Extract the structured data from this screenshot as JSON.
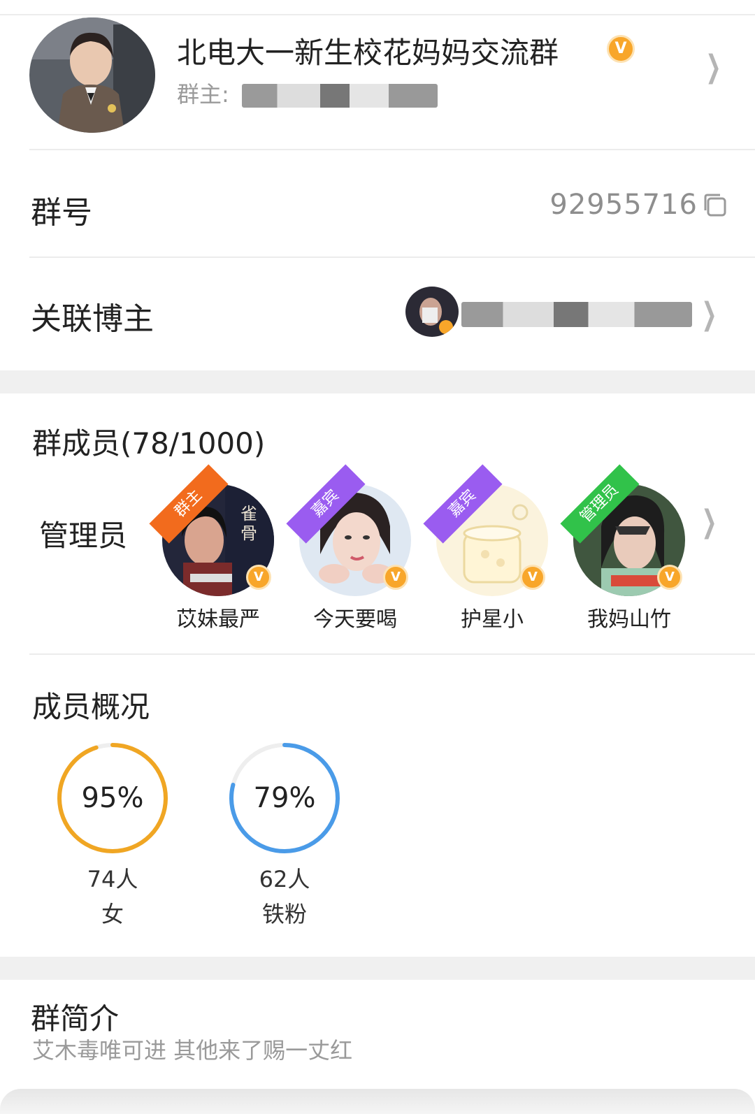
{
  "header": {
    "group_name": "北电大一新生校花妈妈交流群",
    "verified_badge": "V",
    "owner_prefix": "群主:",
    "avatar_icon": "child-portrait-avatar"
  },
  "group_id": {
    "label": "群号",
    "value": "92955716",
    "icon": "copy-icon"
  },
  "linked_blogger": {
    "label": "关联博主",
    "icon": "chevron-right-icon"
  },
  "members": {
    "title": "群成员(78/1000)",
    "admin_label": "管理员",
    "list": [
      {
        "role": "群主",
        "name": "苡妹最严",
        "ribbon_color": "#f26b1d"
      },
      {
        "role": "嘉宾",
        "name": "今天要喝",
        "ribbon_color": "#9a5cf0"
      },
      {
        "role": "嘉宾",
        "name": "护星小",
        "ribbon_color": "#9a5cf0"
      },
      {
        "role": "管理员",
        "name": "我妈山竹",
        "ribbon_color": "#31c24a"
      }
    ]
  },
  "overview": {
    "title": "成员概况",
    "stats": [
      {
        "percent_label": "95%",
        "percent": 95,
        "count": "74人",
        "label": "女",
        "color": "#f0a623"
      },
      {
        "percent_label": "79%",
        "percent": 79,
        "count": "62人",
        "label": "铁粉",
        "color": "#4a9be8"
      }
    ]
  },
  "intro": {
    "title": "群简介",
    "text": "艾木毒唯可进 其他来了赐一丈红"
  }
}
